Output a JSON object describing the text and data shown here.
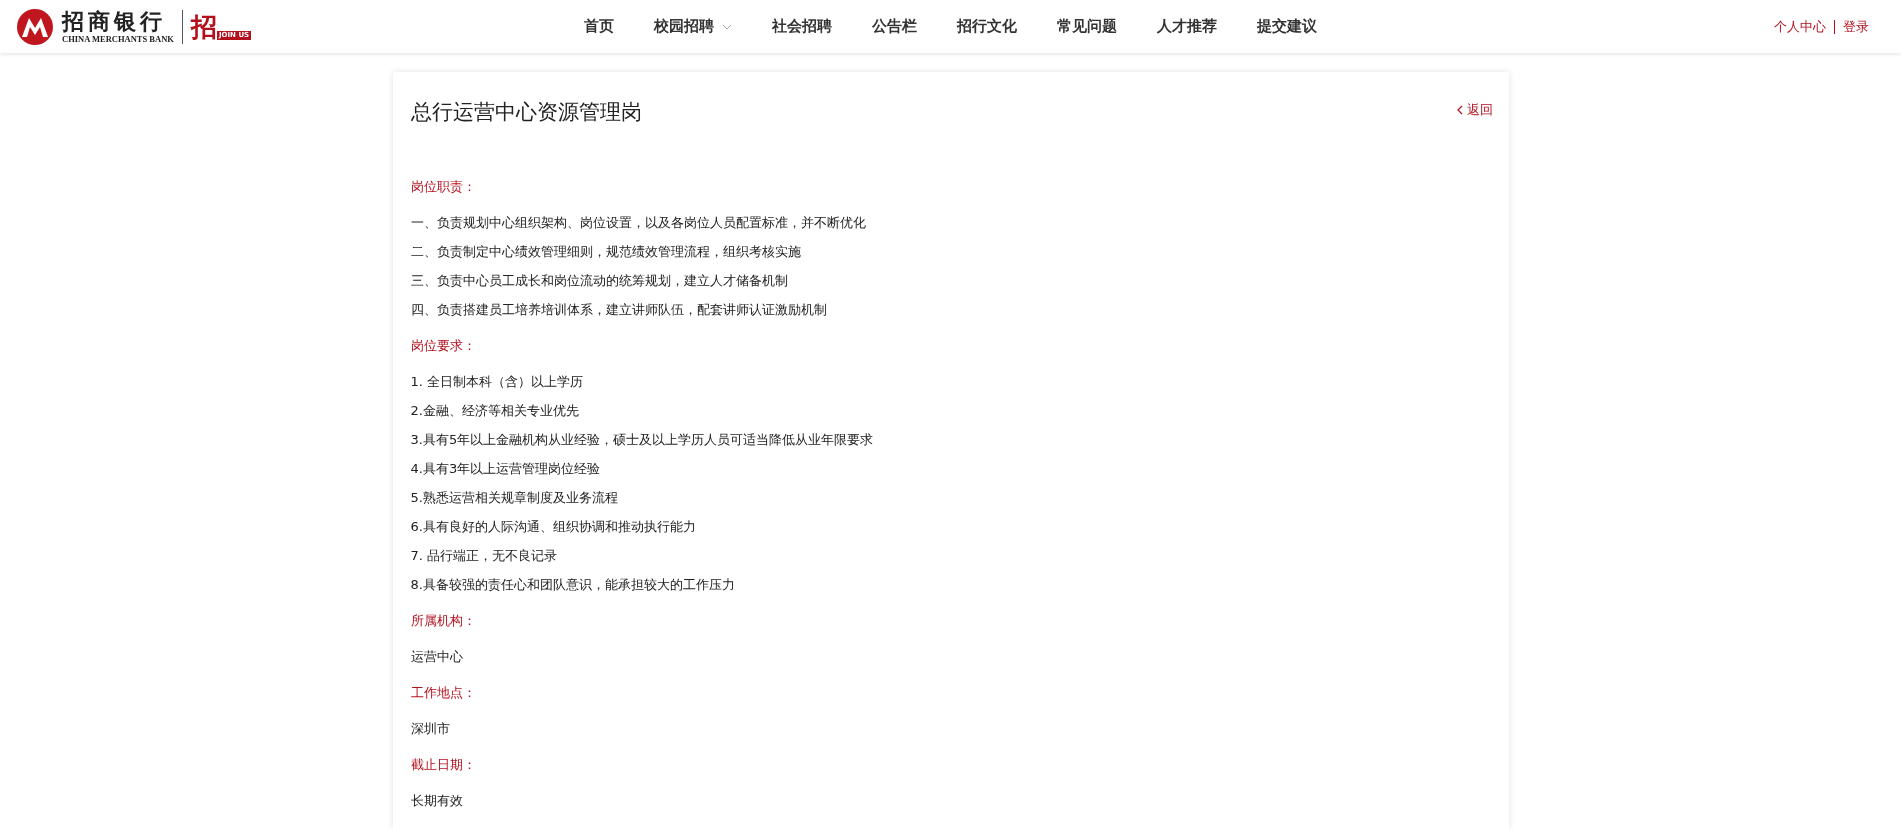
{
  "logo": {
    "name_cn": "招商银行",
    "name_en": "CHINA MERCHANTS BANK",
    "badge_char": "招",
    "badge_text": "JOIN US"
  },
  "nav": [
    {
      "label": "首页",
      "dropdown": false
    },
    {
      "label": "校园招聘",
      "dropdown": true
    },
    {
      "label": "社会招聘",
      "dropdown": false
    },
    {
      "label": "公告栏",
      "dropdown": false
    },
    {
      "label": "招行文化",
      "dropdown": false
    },
    {
      "label": "常见问题",
      "dropdown": false
    },
    {
      "label": "人才推荐",
      "dropdown": false
    },
    {
      "label": "提交建议",
      "dropdown": false
    }
  ],
  "user_links": [
    "个人中心",
    "登录"
  ],
  "job": {
    "title": "总行运营中心资源管理岗",
    "back": "返回",
    "sections": [
      {
        "heading": "岗位职责：",
        "lines": [
          "一、负责规划中心组织架构、岗位设置，以及各岗位人员配置标准，并不断优化",
          "二、负责制定中心绩效管理细则，规范绩效管理流程，组织考核实施",
          "三、负责中心员工成长和岗位流动的统筹规划，建立人才储备机制",
          "四、负责搭建员工培养培训体系，建立讲师队伍，配套讲师认证激励机制"
        ]
      },
      {
        "heading": "岗位要求：",
        "lines": [
          "1. 全日制本科（含）以上学历",
          "2.金融、经济等相关专业优先",
          "3.具有5年以上金融机构从业经验，硕士及以上学历人员可适当降低从业年限要求",
          "4.具有3年以上运营管理岗位经验",
          "5.熟悉运营相关规章制度及业务流程",
          "6.具有良好的人际沟通、组织协调和推动执行能力",
          "7. 品行端正，无不良记录",
          "8.具备较强的责任心和团队意识，能承担较大的工作压力"
        ]
      },
      {
        "heading": "所属机构：",
        "lines": [
          "运营中心"
        ]
      },
      {
        "heading": "工作地点：",
        "lines": [
          "深圳市"
        ]
      },
      {
        "heading": "截止日期：",
        "lines": [
          "长期有效"
        ]
      }
    ]
  }
}
